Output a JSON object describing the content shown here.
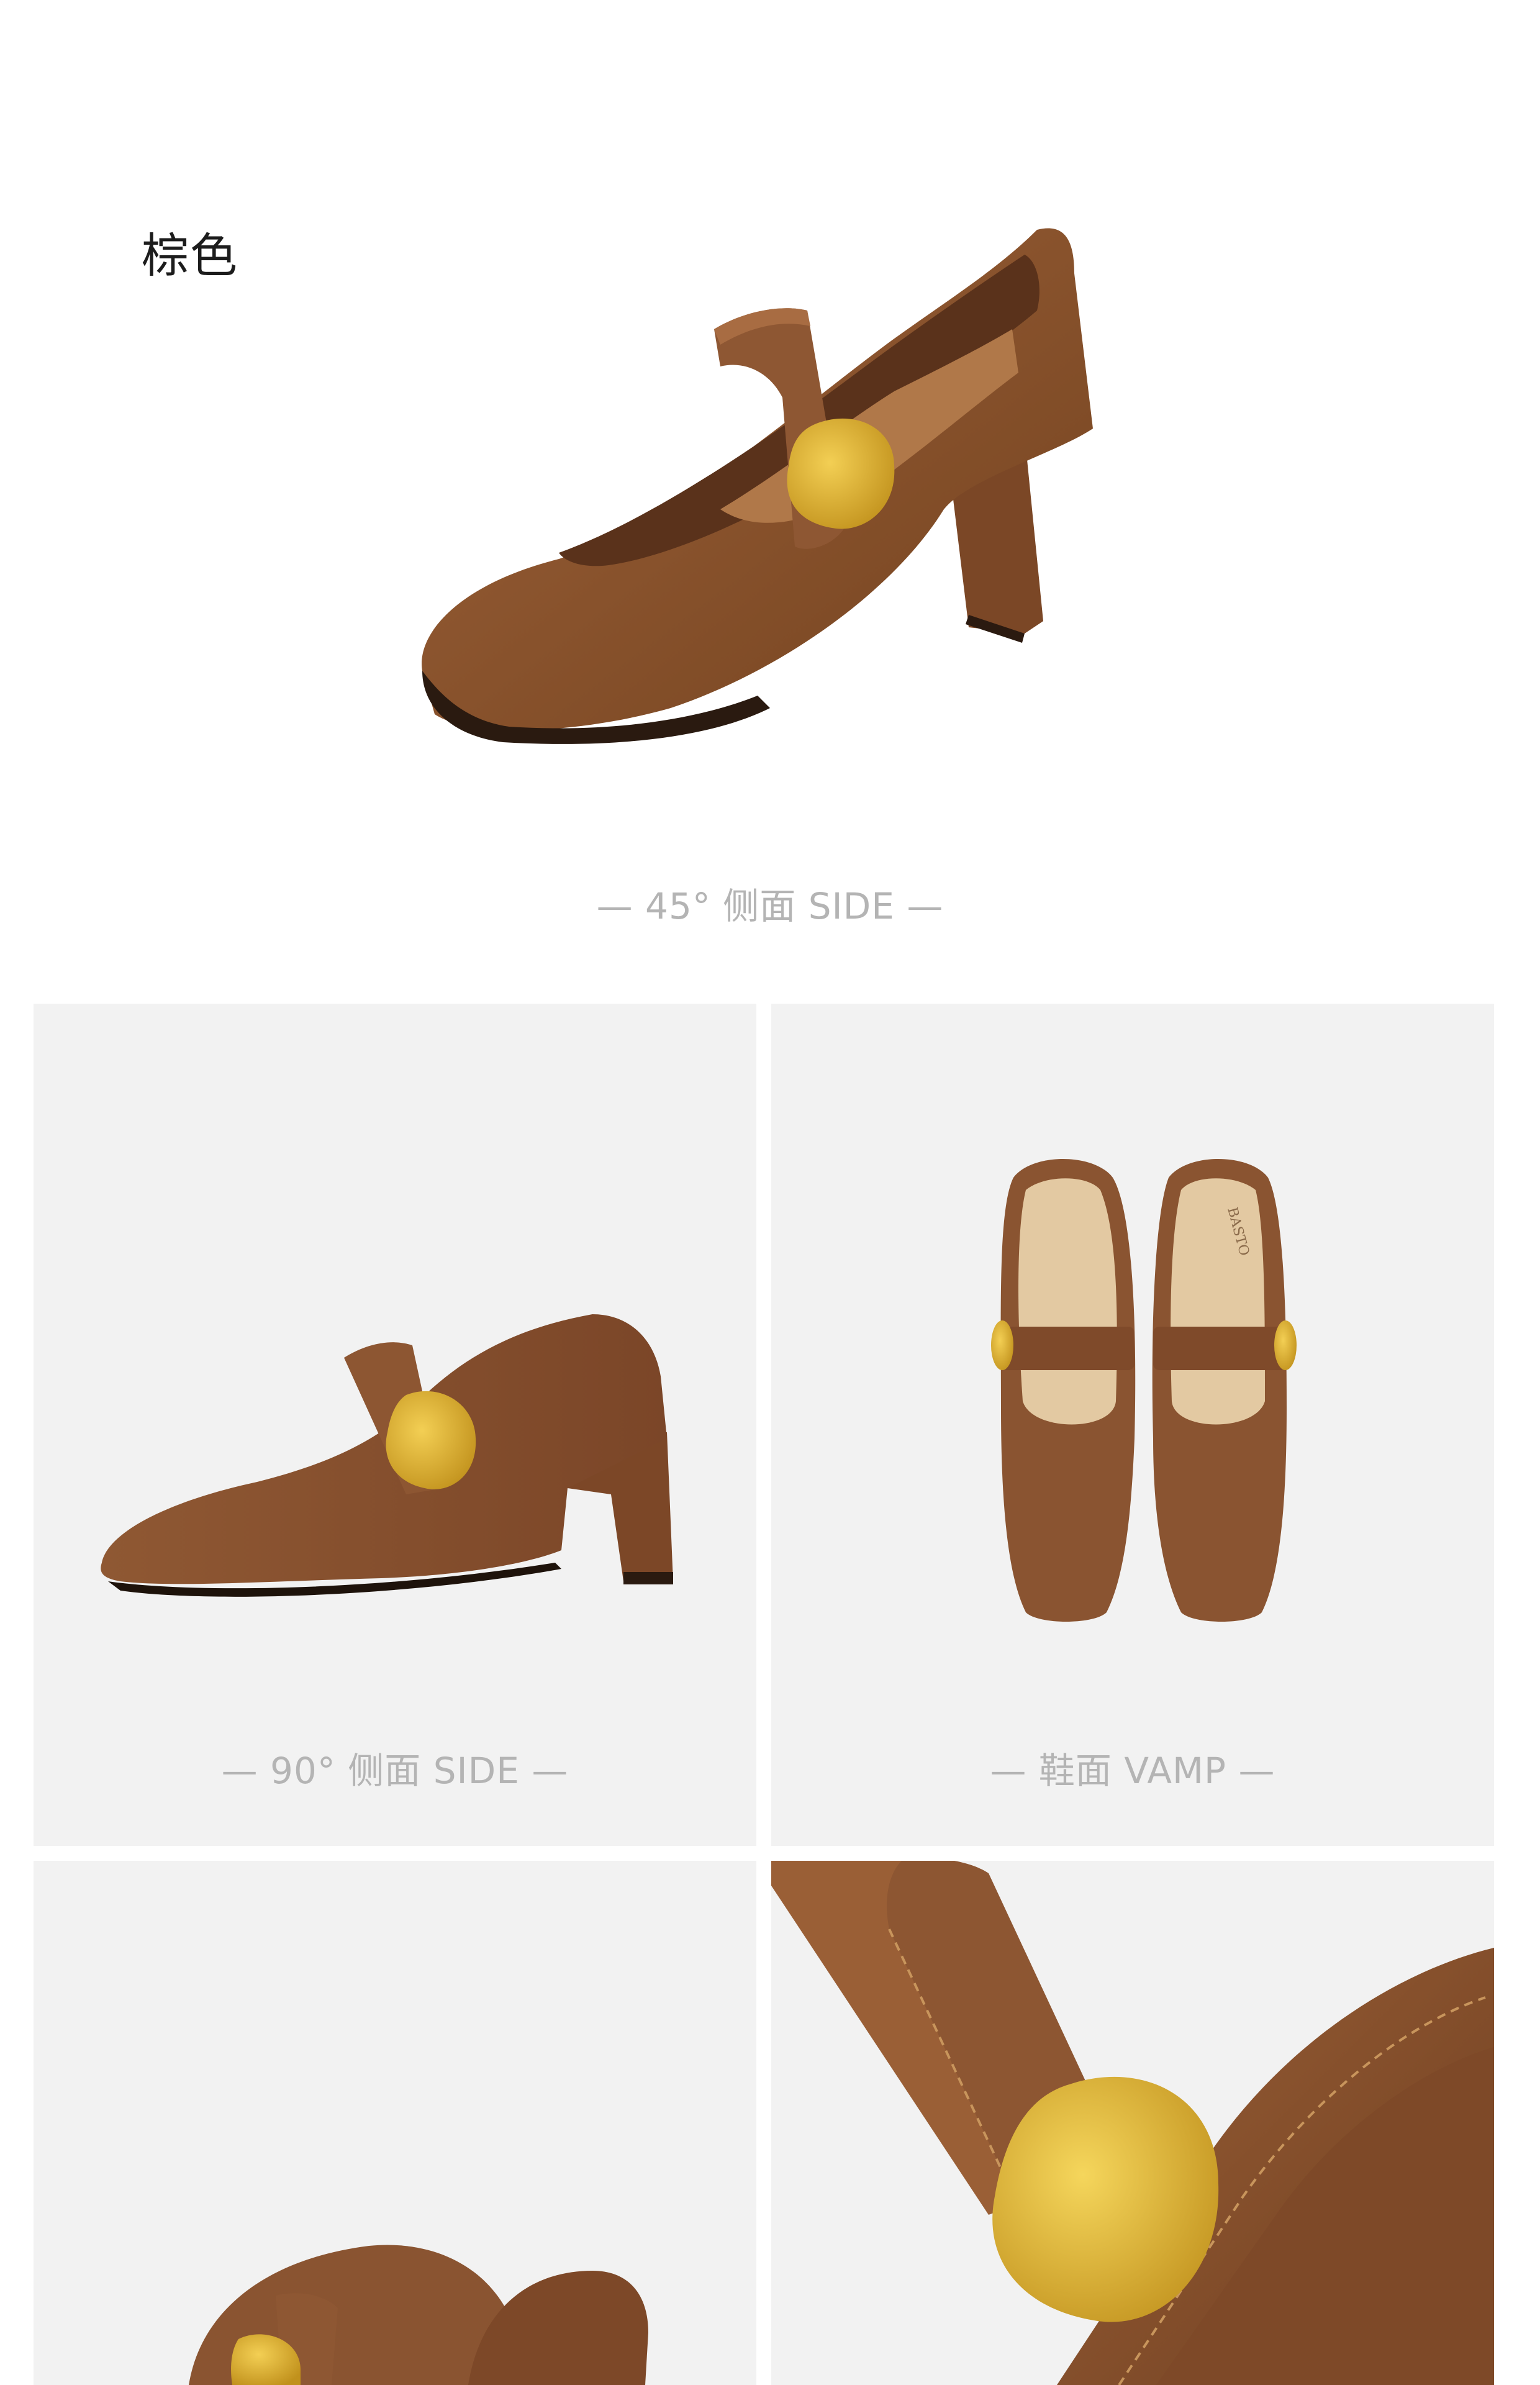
{
  "color_name": "棕色",
  "views": {
    "side_45": "— 45°  侧面 SIDE —",
    "side_90": "— 90°  侧面 SIDE —",
    "vamp": "— 鞋面 VAMP —"
  },
  "insole_brand": "BASTO",
  "palette": {
    "leather": "#8a5431",
    "leather_dark": "#6a3d22",
    "leather_light": "#a56a41",
    "buckle": "#d9a928",
    "insole": "#e3c9a2",
    "panel_bg": "#f2f2f2",
    "caption": "#b4b4b4"
  }
}
